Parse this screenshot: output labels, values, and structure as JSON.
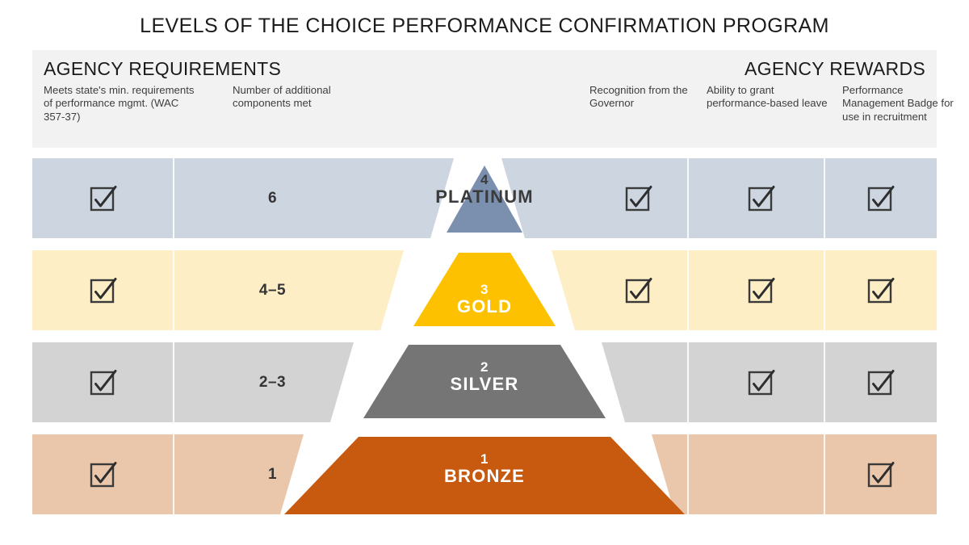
{
  "title": "LEVELS OF THE CHOICE PERFORMANCE CONFIRMATION PROGRAM",
  "header": {
    "requirements_heading": "AGENCY REQUIREMENTS",
    "rewards_heading": "AGENCY REWARDS",
    "columns": [
      "Meets state's min. requirements of performance mgmt. (WAC 357-37)",
      "Number of additional components met",
      "",
      "Recognition from the Governor",
      "Ability to grant performance-based leave",
      "Performance Management Badge for use in recruitment"
    ]
  },
  "icons": {
    "check": "checkbox-checked-icon"
  },
  "colors": {
    "band": "#f2f2f2",
    "row_platinum": "#ccd5e0",
    "row_gold": "#fdeec6",
    "row_silver": "#d3d3d3",
    "row_bronze": "#eac7ab",
    "tier_platinum": "#7b8fae",
    "tier_gold": "#fdc100",
    "tier_silver": "#757575",
    "tier_bronze": "#c85a10",
    "title_text": "#1b1b1b",
    "cell_text": "#343434"
  },
  "rows": [
    {
      "tier_number": "4",
      "tier_name": "PLATINUM",
      "meets_min_requirements": true,
      "components_met": "6",
      "recognition_from_governor": true,
      "performance_based_leave": true,
      "performance_badge": true
    },
    {
      "tier_number": "3",
      "tier_name": "GOLD",
      "meets_min_requirements": true,
      "components_met": "4–5",
      "recognition_from_governor": true,
      "performance_based_leave": true,
      "performance_badge": true
    },
    {
      "tier_number": "2",
      "tier_name": "SILVER",
      "meets_min_requirements": true,
      "components_met": "2–3",
      "recognition_from_governor": false,
      "performance_based_leave": true,
      "performance_badge": true
    },
    {
      "tier_number": "1",
      "tier_name": "BRONZE",
      "meets_min_requirements": true,
      "components_met": "1",
      "recognition_from_governor": false,
      "performance_based_leave": false,
      "performance_badge": true
    }
  ]
}
